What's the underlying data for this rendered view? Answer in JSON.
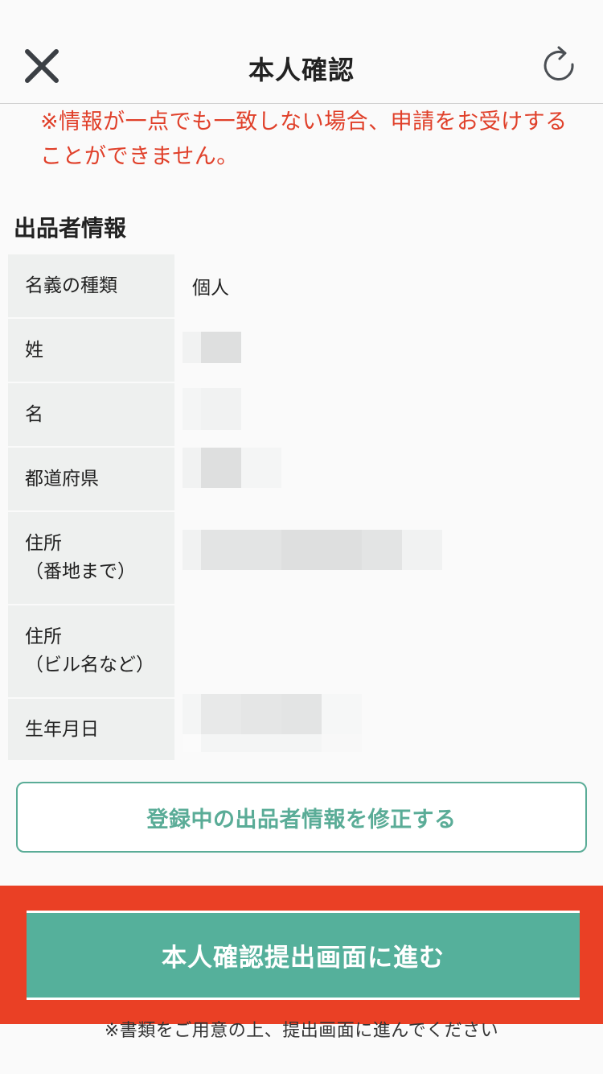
{
  "header": {
    "title": "本人確認",
    "close_icon": "close-icon",
    "reload_icon": "reload-icon"
  },
  "warning": "※情報が一点でも一致しない場合、申請をお受けすることができません。",
  "section_title": "出品者情報",
  "rows": [
    {
      "label": "名義の種類",
      "value": "個人"
    },
    {
      "label": "姓",
      "value": ""
    },
    {
      "label": "名",
      "value": ""
    },
    {
      "label": "都道府県",
      "value": ""
    },
    {
      "label": "住所\n（番地まで）",
      "value": ""
    },
    {
      "label": "住所\n（ビル名など）",
      "value": ""
    },
    {
      "label": "生年月日",
      "value": ""
    }
  ],
  "edit_button": "登録中の出品者情報を修正する",
  "proceed_button": "本人確認提出画面に進む",
  "footnote": "※書類をご用意の上、提出画面に進んでください",
  "colors": {
    "accent": "#55b09b",
    "warning": "#e0402a",
    "highlight": "#ea4025",
    "label_bg": "#eef0ef"
  }
}
